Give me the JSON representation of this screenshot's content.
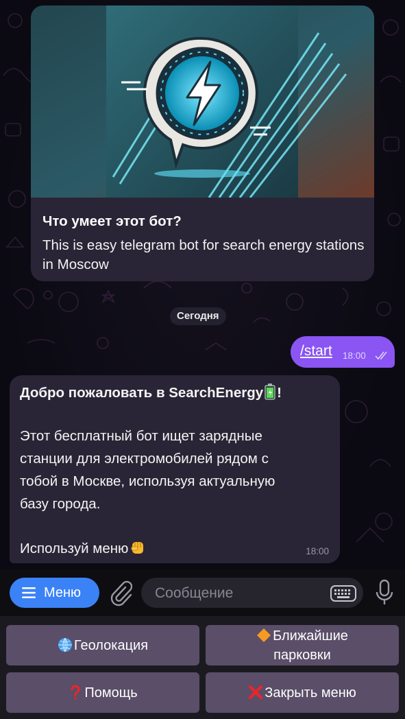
{
  "intro": {
    "title": "Что умеет этот бот?",
    "description": "This is easy telegram bot for search energy stations in Moscow"
  },
  "date_separator": "Сегодня",
  "outgoing": {
    "text": "/start",
    "time": "18:00"
  },
  "incoming": {
    "welcome_prefix": "Добро пожаловать в SearchEnergy",
    "welcome_suffix": "!",
    "line1": "Этот бесплатный бот ищет зарядные",
    "line2": "станции для электромобилей рядом с",
    "line3": "тобой в Москве, используя актуальную",
    "line4": "базу города.",
    "menu_hint": "Используй меню",
    "time": "18:00"
  },
  "input_bar": {
    "menu_label": "Меню",
    "placeholder": "Сообщение"
  },
  "keyboard": {
    "geo": "Геолокация",
    "parking_line1": "Ближайшие",
    "parking_line2": "парковки",
    "help": "Помощь",
    "close": "Закрыть меню"
  },
  "colors": {
    "accent_blue": "#3b82f6",
    "outgoing_bubble": "#8a55f2",
    "incoming_bubble": "#2a2536",
    "keyboard_button": "#5a4e68"
  },
  "icons": [
    "lightning-logo-icon",
    "double-check-icon",
    "battery-emoji-icon",
    "fist-emoji-icon",
    "hamburger-icon",
    "paperclip-icon",
    "keyboard-icon",
    "microphone-icon",
    "globe-emoji-icon",
    "diamond-emoji-icon",
    "question-emoji-icon",
    "cross-emoji-icon"
  ]
}
